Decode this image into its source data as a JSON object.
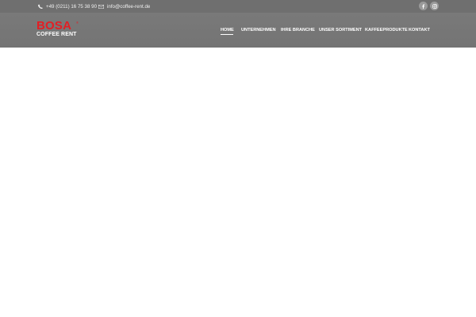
{
  "topbar": {
    "phone": "+49 (0211) 16 75 38 90",
    "email": "info@coffee-rent.de"
  },
  "logo": {
    "brand": "BOSA",
    "mark": "®",
    "subtitle": "COFFEE RENT"
  },
  "nav": {
    "items": [
      {
        "label": "HOME",
        "active": true
      },
      {
        "label": "UNTERNEHMEN"
      },
      {
        "label": "IHRE BRANCHE"
      },
      {
        "label": "UNSER SORTIMENT"
      },
      {
        "label": "KAFFEEPRODUKTE"
      },
      {
        "label": "KONTAKT"
      }
    ]
  },
  "social": {
    "facebook_icon": "facebook-icon",
    "instagram_icon": "instagram-icon"
  },
  "colors": {
    "header_bg": "#787878",
    "topbar_bg": "#6f6f6f",
    "brand_red": "#e31e24",
    "nav_text": "#ffffff"
  }
}
